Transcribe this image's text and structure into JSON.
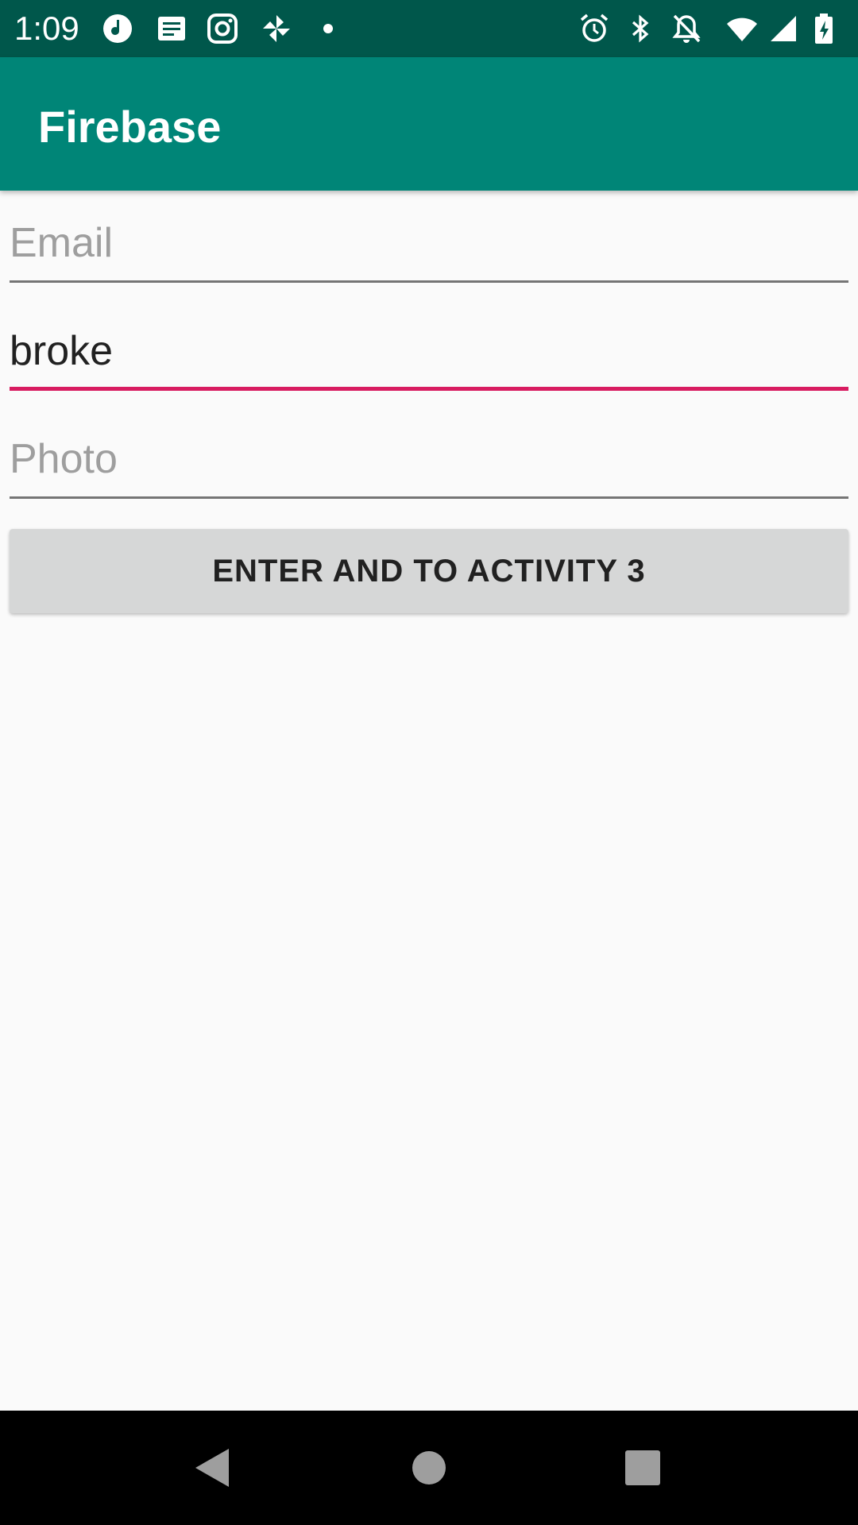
{
  "status_bar": {
    "time": "1:09",
    "left_icons": [
      "music-note-icon",
      "news-icon",
      "instagram-icon",
      "pinwheel-icon",
      "dot-icon"
    ],
    "right_icons": [
      "alarm-icon",
      "bluetooth-icon",
      "notifications-off-icon",
      "wifi-icon",
      "cell-signal-icon",
      "battery-charging-icon"
    ]
  },
  "app_bar": {
    "title": "Firebase"
  },
  "form": {
    "email": {
      "placeholder": "Email",
      "value": ""
    },
    "password": {
      "value": "broke"
    },
    "photo": {
      "placeholder": "Photo",
      "value": ""
    },
    "submit_label": "ENTER AND TO ACTIVITY 3"
  },
  "nav_bar": {
    "icons": [
      "back-icon",
      "home-icon",
      "recents-icon"
    ]
  },
  "colors": {
    "status_bar": "#00574b",
    "app_bar": "#008577",
    "accent": "#d81b60",
    "button": "#d6d7d7",
    "background": "#fafafa"
  }
}
